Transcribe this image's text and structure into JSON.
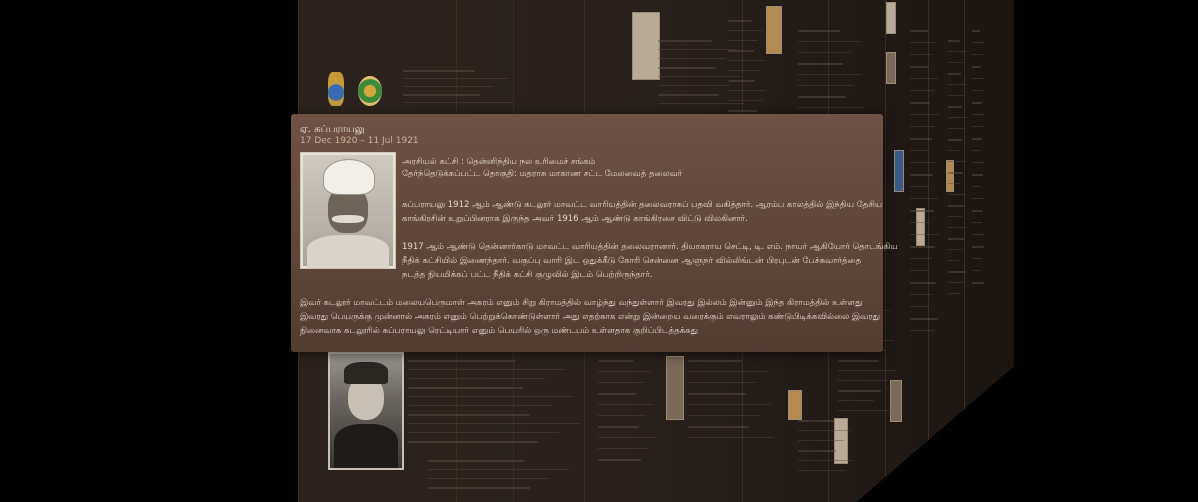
{
  "card": {
    "name": "ஏ. சுப்பராயலு",
    "dates": "17 Dec 1920 – 11 Jul 1921",
    "line_party": "அரசியல் கட்சி : தென்னிந்திய நல உரிமைச் சங்கம்",
    "line_constituency": "தேர்ந்தெடுக்கப்பட்ட தொகுதி: மதராசு மாகாண சட்ட மேலவைத் தலைவர்",
    "para1_l1": "சுப்பராயலு 1912 ஆம் ஆண்டு கடலூர் மாவட்ட வாரியத்தின் தலைவராகப் பதவி வகித்தார். ஆரம்ப காலத்தில் இந்திய தேசிய",
    "para1_l2": "காங்கிரசின் உறுப்பினராக இருந்த அவர் 1916 ஆம் ஆண்டு காங்கிரசை விட்டு விலகினார்.",
    "para2_l1": "1917 ஆம் ஆண்டு தென்னார்காடு மாவட்ட வாரியத்தின் தலைவரானார். தியாகராய செட்டி, டி. எம். நாயர் ஆகியோர் தொடங்கிய",
    "para2_l2": "நீதிக் கட்சியில் இணைந்தார். வகுப்பு வாரி இட ஒதுக்கீடு கோரி சென்னை ஆளுநர் வில்லிங்டன் பிரபுடன் பேச்சுவார்த்தை",
    "para2_l3": "நடத்த நியமிக்கப் பட்ட நீதிக் கட்சி குழுவில் இடம் பெற்றிருந்தார்.",
    "para3_l1": "இவர் கடலூர் மாவட்டம் மலையபெருமாள் அகரம் எனும் சிறு கிராமத்தில் வாழ்ந்து வந்துள்ளார் இவரது இல்லம் இன்னும் இந்த கிராமத்தில் உள்ளது",
    "para3_l2": "இவரது பெயருக்கு முன்னால் அகரம் எனும் பெற்றுக்கொண்டுள்ளார் அது எதற்காக என்று இன்றைய வரைக்கும் எவராலும் கண்டுபிடிக்கவில்லை இவரது",
    "para3_l3": "நினைவாக கடலூரில் சுப்பராயலு ரெட்டியார் எனும் பெயரில் ஒரு மண்டபம் உள்ளதாக குறிப்பிடத்தக்கது"
  },
  "colors": {
    "background": "#000000",
    "wall": "#2c221d",
    "card": "#5e463b",
    "text": "#e4d7ca"
  }
}
